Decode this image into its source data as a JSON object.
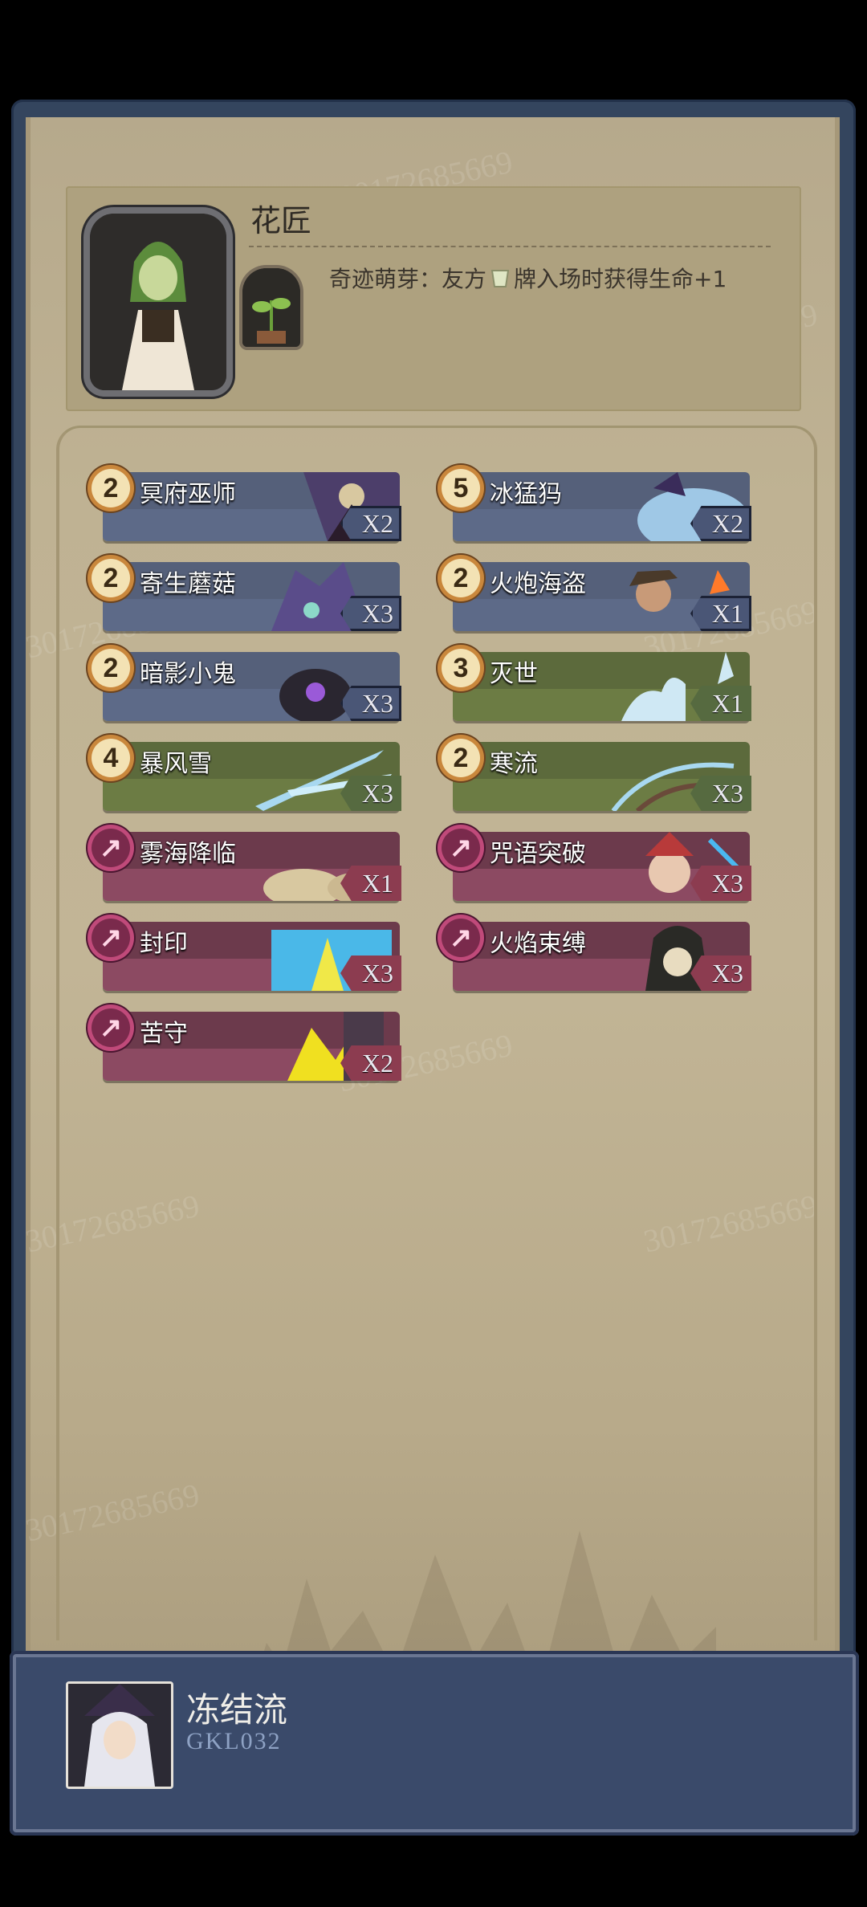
{
  "hero": {
    "name": "花匠",
    "skill_prefix": "奇迹萌芽：友方",
    "skill_suffix": "牌入场时获得生命+1"
  },
  "cards": [
    {
      "cost": "2",
      "name": "冥府巫师",
      "count": "X2",
      "type": "minion"
    },
    {
      "cost": "5",
      "name": "冰猛犸",
      "count": "X2",
      "type": "minion"
    },
    {
      "cost": "2",
      "name": "寄生蘑菇",
      "count": "X3",
      "type": "minion"
    },
    {
      "cost": "2",
      "name": "火炮海盗",
      "count": "X1",
      "type": "minion"
    },
    {
      "cost": "2",
      "name": "暗影小鬼",
      "count": "X3",
      "type": "minion"
    },
    {
      "cost": "3",
      "name": "灭世",
      "count": "X1",
      "type": "spell"
    },
    {
      "cost": "4",
      "name": "暴风雪",
      "count": "X3",
      "type": "spell"
    },
    {
      "cost": "2",
      "name": "寒流",
      "count": "X3",
      "type": "spell"
    },
    {
      "cost": "",
      "name": "雾海降临",
      "count": "X1",
      "type": "secret"
    },
    {
      "cost": "",
      "name": "咒语突破",
      "count": "X3",
      "type": "secret"
    },
    {
      "cost": "",
      "name": "封印",
      "count": "X3",
      "type": "secret"
    },
    {
      "cost": "",
      "name": "火焰束缚",
      "count": "X3",
      "type": "secret"
    },
    {
      "cost": "",
      "name": "苦守",
      "count": "X2",
      "type": "secret"
    }
  ],
  "deck": {
    "name": "冻结流",
    "code": "GKL032"
  },
  "watermark": "30172685669",
  "icons": {
    "cost_badge": "coin-badge-icon",
    "secret_badge": "arrow-badge-icon",
    "cup": "cup-icon"
  },
  "colors": {
    "minion": "#5d6a88",
    "spell": "#6c7c44",
    "secret": "#8c4a62",
    "footer": "#3a4a6a"
  }
}
